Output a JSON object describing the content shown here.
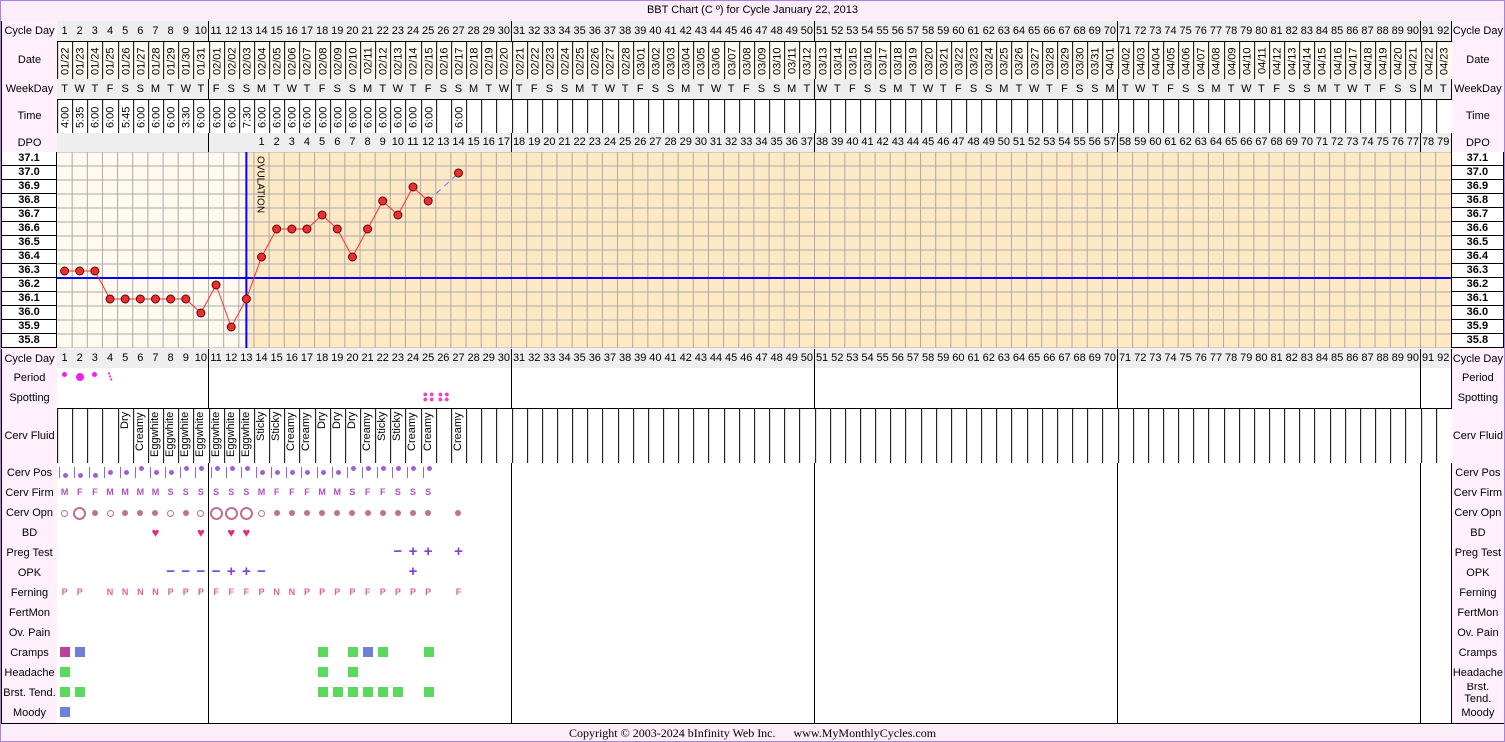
{
  "title": "BBT Chart (C º) for Cycle January 22, 2013",
  "labels": {
    "cycle_day": "Cycle Day",
    "date": "Date",
    "weekday": "WeekDay",
    "time": "Time",
    "dpo": "DPO",
    "period": "Period",
    "spotting": "Spotting",
    "cerv_fluid": "Cerv Fluid",
    "cerv_pos": "Cerv Pos",
    "cerv_firm": "Cerv Firm",
    "cerv_opn": "Cerv Opn",
    "bd": "BD",
    "preg_test": "Preg Test",
    "opk": "OPK",
    "ferning": "Ferning",
    "fertmon": "FertMon",
    "ov_pain": "Ov. Pain",
    "cramps": "Cramps",
    "headache": "Headache",
    "brst_tend": "Brst. Tend.",
    "moody": "Moody"
  },
  "dates": [
    "01/22",
    "01/23",
    "01/24",
    "01/25",
    "01/26",
    "01/27",
    "01/28",
    "01/29",
    "01/30",
    "01/31",
    "02/01",
    "02/02",
    "02/03",
    "02/04",
    "02/05",
    "02/06",
    "02/07",
    "02/08",
    "02/09",
    "02/10",
    "02/11",
    "02/12",
    "02/13",
    "02/14",
    "02/15",
    "02/16",
    "02/17",
    "02/18",
    "02/19",
    "02/20",
    "02/21",
    "02/22",
    "02/23",
    "02/24",
    "02/25",
    "02/26",
    "02/27",
    "02/28",
    "03/01",
    "03/02",
    "03/03",
    "03/04",
    "03/05",
    "03/06",
    "03/07",
    "03/08",
    "03/09",
    "03/10",
    "03/11",
    "03/12",
    "03/13",
    "03/14",
    "03/15",
    "03/16",
    "03/17",
    "03/18",
    "03/19",
    "03/20",
    "03/21",
    "03/22",
    "03/23",
    "03/24",
    "03/25",
    "03/26",
    "03/27",
    "03/28",
    "03/29",
    "03/30",
    "03/31",
    "04/01",
    "04/02",
    "04/03",
    "04/04",
    "04/05",
    "04/06",
    "04/07",
    "04/08",
    "04/09",
    "04/10",
    "04/11",
    "04/12",
    "04/13",
    "04/14",
    "04/15",
    "04/16",
    "04/17",
    "04/18",
    "04/19",
    "04/20",
    "04/21",
    "04/22",
    "04/23"
  ],
  "weekdays": [
    "T",
    "W",
    "T",
    "F",
    "S",
    "S",
    "M"
  ],
  "times": [
    "4:00",
    "5:35",
    "6:00",
    "6:00",
    "5:45",
    "6:00",
    "6:00",
    "6:00",
    "3:30",
    "6:00",
    "6:00",
    "6:00",
    "7:30",
    "6:00",
    "6:00",
    "6:00",
    "6:00",
    "6:00",
    "6:00",
    "6:00",
    "6:00",
    "6:00",
    "6:00",
    "6:00",
    "6:00",
    "",
    "6:00"
  ],
  "dpo_start_day": 14,
  "temps": [
    36.3,
    36.3,
    36.3,
    36.1,
    36.1,
    36.1,
    36.1,
    36.1,
    36.1,
    36.0,
    36.2,
    35.9,
    36.1,
    36.4,
    36.6,
    36.6,
    36.6,
    36.7,
    36.6,
    36.4,
    36.6,
    36.8,
    36.7,
    36.9,
    36.8,
    null,
    37.0
  ],
  "temp_scale": [
    "37.1",
    "37.0",
    "36.9",
    "36.8",
    "36.7",
    "36.6",
    "36.5",
    "36.4",
    "36.3",
    "36.2",
    "36.1",
    "36.0",
    "35.9",
    "35.8"
  ],
  "coverline": 36.25,
  "ovulation_day": 13,
  "ovulation_label": "OVULATION",
  "period": [
    "medium",
    "heavy",
    "medium",
    "light"
  ],
  "spotting_days": [
    25,
    26
  ],
  "cerv_fluid": [
    "",
    "",
    "",
    "",
    "Dry",
    "Creamy",
    "Eggwhite",
    "Eggwhite",
    "Eggwhite",
    "Eggwhite",
    "Eggwhite",
    "Eggwhite",
    "Eggwhite",
    "Sticky",
    "Sticky",
    "Creamy",
    "Creamy",
    "Dry",
    "Dry",
    "Dry",
    "Creamy",
    "Sticky",
    "Sticky",
    "Creamy",
    "Creamy",
    "",
    "Creamy"
  ],
  "cerv_pos": [
    "low",
    "low",
    "low",
    "medium",
    "medium",
    "high",
    "medium",
    "medium",
    "high",
    "high",
    "high",
    "high",
    "high",
    "medium",
    "medium",
    "medium",
    "medium",
    "medium",
    "medium",
    "high",
    "high",
    "high",
    "high",
    "high",
    "high"
  ],
  "cerv_firm": [
    "M",
    "F",
    "F",
    "M",
    "M",
    "M",
    "M",
    "S",
    "S",
    "S",
    "S",
    "S",
    "S",
    "M",
    "F",
    "F",
    "F",
    "M",
    "M",
    "S",
    "F",
    "F",
    "S",
    "S",
    "S"
  ],
  "cerv_opn": [
    "medium",
    "open",
    "closed",
    "medium",
    "closed",
    "closed",
    "closed",
    "medium",
    "closed",
    "medium",
    "open",
    "open",
    "open",
    "medium",
    "closed",
    "closed",
    "closed",
    "closed",
    "closed",
    "closed",
    "closed",
    "closed",
    "closed",
    "closed",
    "closed",
    "",
    "closed"
  ],
  "bd_days": [
    7,
    10,
    12,
    13
  ],
  "preg_test": {
    "23": "−",
    "24": "+",
    "25": "+",
    "27": "+"
  },
  "opk": {
    "8": "−",
    "9": "−",
    "10": "−",
    "11": "−",
    "12": "+",
    "13": "+",
    "14": "−",
    "24": "+"
  },
  "ferning": [
    "P",
    "P",
    "",
    "N",
    "N",
    "N",
    "N",
    "P",
    "P",
    "P",
    "F",
    "F",
    "F",
    "P",
    "N",
    "N",
    "P",
    "P",
    "P",
    "P",
    "F",
    "P",
    "P",
    "P",
    "P",
    "",
    "F"
  ],
  "cramps": {
    "1": "#c040a0",
    "2": "#7080d8",
    "18": "#5cd860",
    "20": "#5cd860",
    "21": "#7080d8",
    "22": "#5cd860",
    "25": "#5cd860"
  },
  "headache": {
    "1": "#5cd860",
    "18": "#5cd860",
    "20": "#5cd860"
  },
  "brst_tend": {
    "1": "#5cd860",
    "2": "#5cd860",
    "18": "#5cd860",
    "19": "#5cd860",
    "20": "#5cd860",
    "21": "#5cd860",
    "22": "#5cd860",
    "23": "#5cd860",
    "25": "#5cd860"
  },
  "moody": {
    "1": "#7080d8"
  },
  "colors": {
    "line": "#ff3030",
    "point": "#e83030",
    "coverline": "#0000ff",
    "post_ov_bg": "#ffe8c4",
    "pre_ov_bg": "#fffaf0",
    "period": "#ee22ee",
    "spotting": "#ee44bb",
    "heart": "#e0307a",
    "cerv_pos": "#a060d0",
    "cerv_opn": "#c07090"
  },
  "footer": "Copyright © 2003-2024 bInfinity Web Inc.      www.MyMonthlyCycles.com"
}
